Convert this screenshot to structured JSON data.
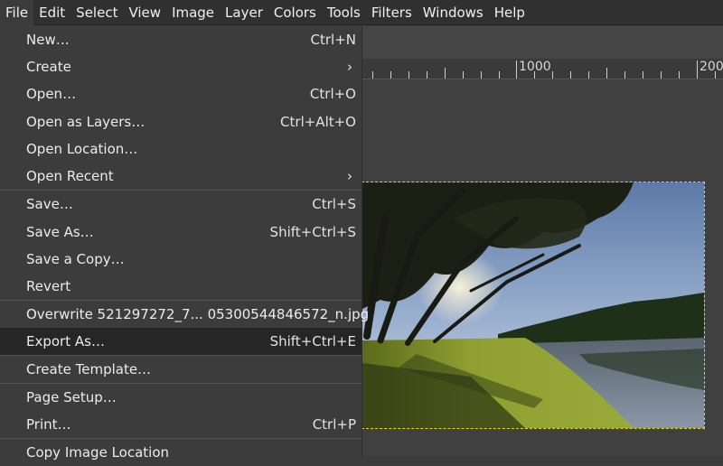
{
  "menubar": {
    "items": [
      "File",
      "Edit",
      "Select",
      "View",
      "Image",
      "Layer",
      "Colors",
      "Tools",
      "Filters",
      "Windows",
      "Help"
    ]
  },
  "ruler": {
    "labels": [
      "1000",
      "200"
    ]
  },
  "file_menu": {
    "items": [
      {
        "label": "New…",
        "shortcut": "Ctrl+N"
      },
      {
        "label": "Create",
        "submenu": true
      },
      {
        "label": "Open…",
        "shortcut": "Ctrl+O"
      },
      {
        "label": "Open as Layers…",
        "shortcut": "Ctrl+Alt+O"
      },
      {
        "label": "Open Location…",
        "shortcut": ""
      },
      {
        "label": "Open Recent",
        "submenu": true
      },
      {
        "label": "Save…",
        "shortcut": "Ctrl+S"
      },
      {
        "label": "Save As…",
        "shortcut": "Shift+Ctrl+S"
      },
      {
        "label": "Save a Copy…",
        "shortcut": ""
      },
      {
        "label": "Revert",
        "shortcut": ""
      },
      {
        "label": "Overwrite 521297272_7... 05300544846572_n.jpg",
        "shortcut": ""
      },
      {
        "label": "Export As…",
        "shortcut": "Shift+Ctrl+E"
      },
      {
        "label": "Create Template…",
        "shortcut": ""
      },
      {
        "label": "Page Setup…",
        "shortcut": ""
      },
      {
        "label": "Print…",
        "shortcut": "Ctrl+P"
      },
      {
        "label": "Copy Image Location",
        "shortcut": ""
      }
    ],
    "highlighted_index": 11,
    "submenu_arrow": "›"
  },
  "colors": {
    "selection_outline": "#e0e000",
    "menu_bg": "#3c3c3c",
    "menu_highlight": "#262626"
  }
}
